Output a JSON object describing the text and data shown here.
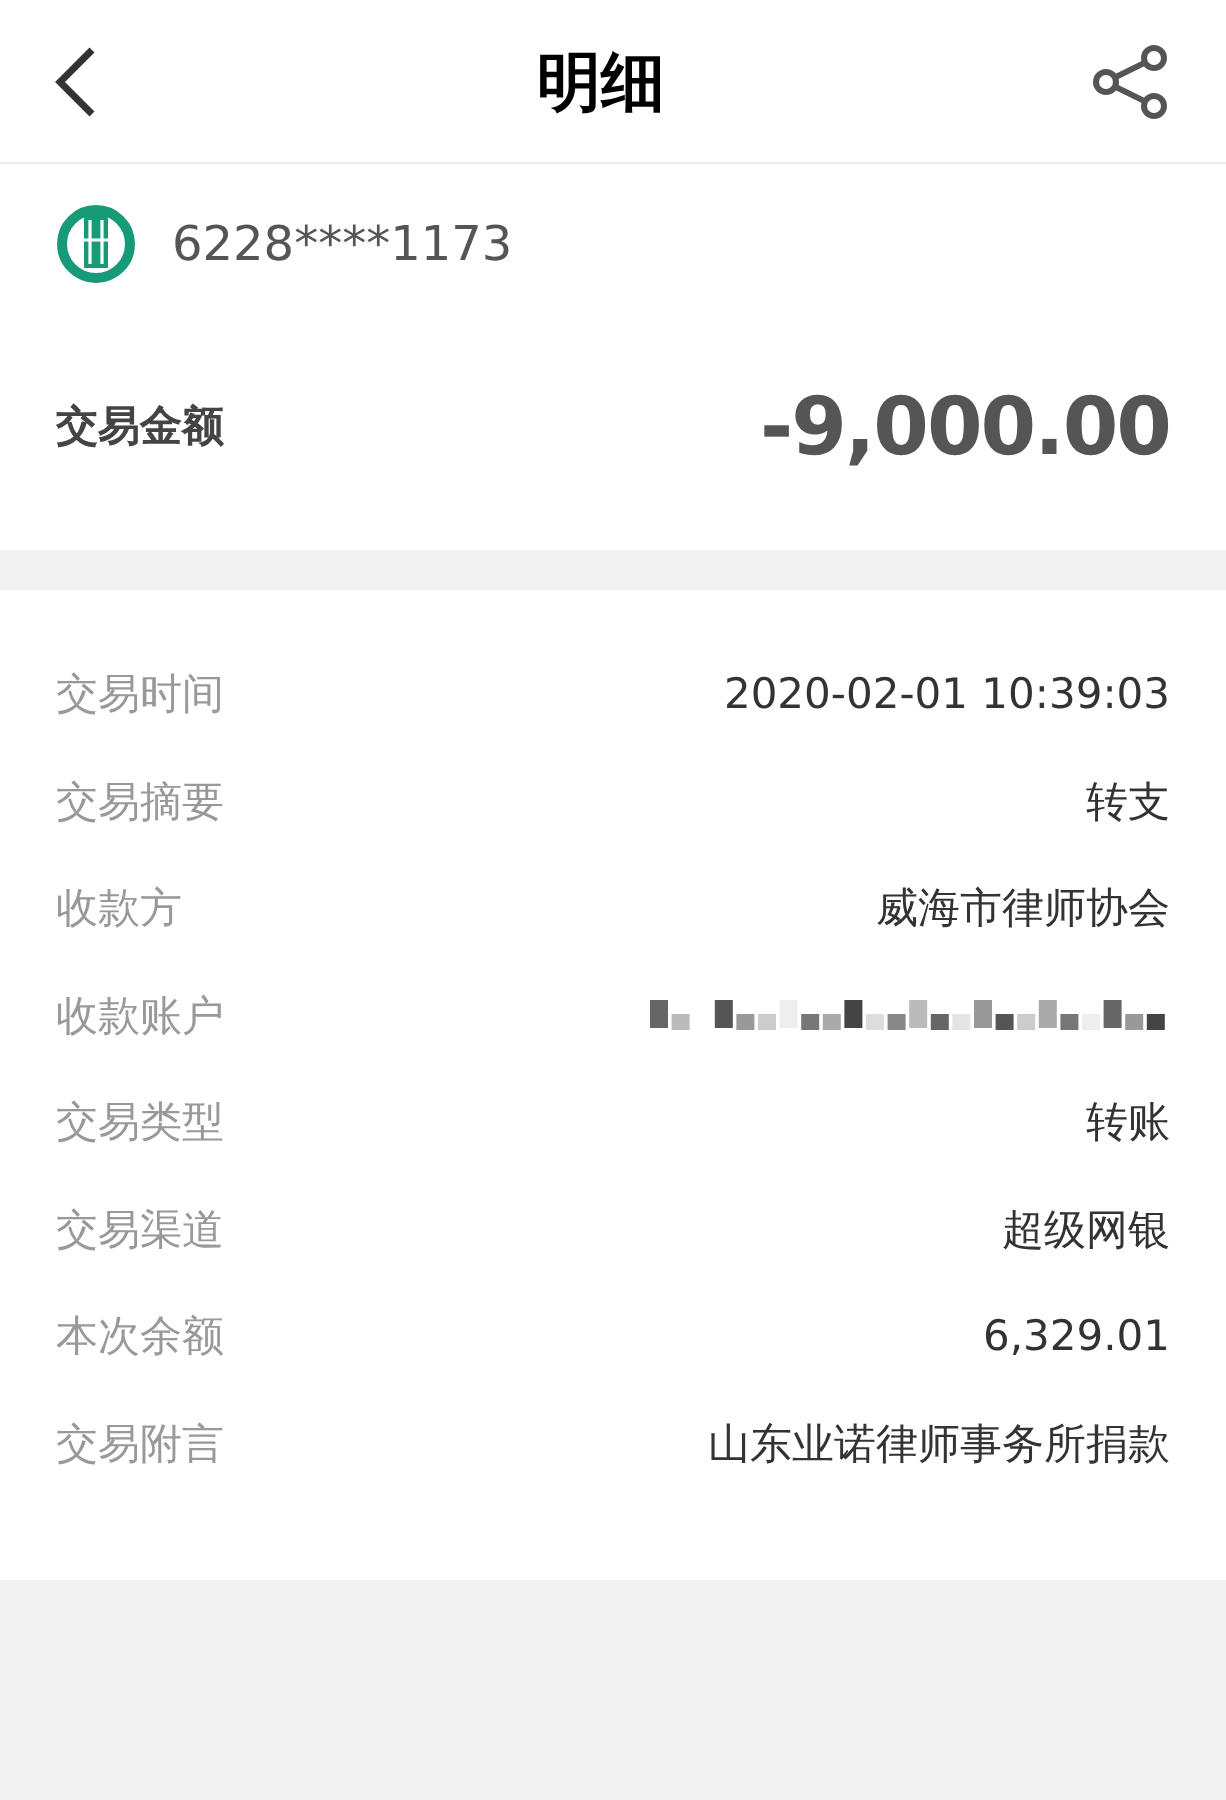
{
  "header": {
    "title": "明细"
  },
  "account": {
    "number": "6228****1173"
  },
  "amount": {
    "label": "交易金额",
    "value": "-9,000.00"
  },
  "details": [
    {
      "kind": "text",
      "label": "交易时间",
      "value": "2020-02-01 10:39:03"
    },
    {
      "kind": "text",
      "label": "交易摘要",
      "value": "转支"
    },
    {
      "kind": "text",
      "label": "收款方",
      "value": "威海市律师协会"
    },
    {
      "kind": "redacted",
      "label": "收款账户"
    },
    {
      "kind": "text",
      "label": "交易类型",
      "value": "转账"
    },
    {
      "kind": "text",
      "label": "交易渠道",
      "value": "超级网银"
    },
    {
      "kind": "text",
      "label": "本次余额",
      "value": "6,329.01"
    },
    {
      "kind": "text",
      "label": "交易附言",
      "value": "山东业诺律师事务所捐款"
    }
  ]
}
